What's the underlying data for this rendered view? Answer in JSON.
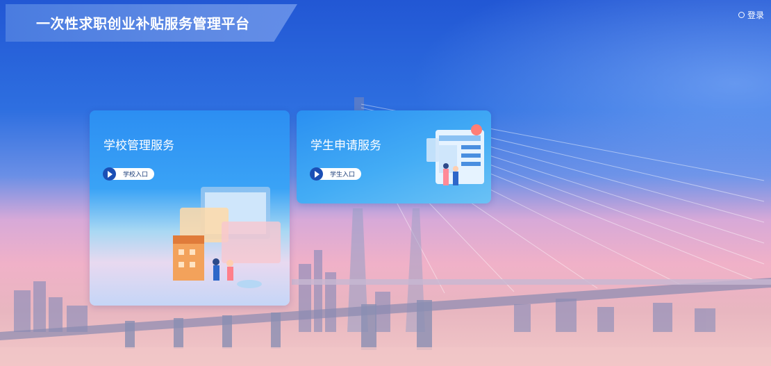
{
  "header": {
    "title": "一次性求职创业补贴服务管理平台",
    "login_label": "登录"
  },
  "cards": [
    {
      "title": "学校管理服务",
      "entry_label": "学校入口",
      "icon": "school-management-illustration"
    },
    {
      "title": "学生申请服务",
      "entry_label": "学生入口",
      "icon": "student-application-illustration"
    }
  ],
  "colors": {
    "brand_blue": "#2257d4",
    "card_blue": "#2c8ef2",
    "entry_play": "#1b4fb5"
  }
}
